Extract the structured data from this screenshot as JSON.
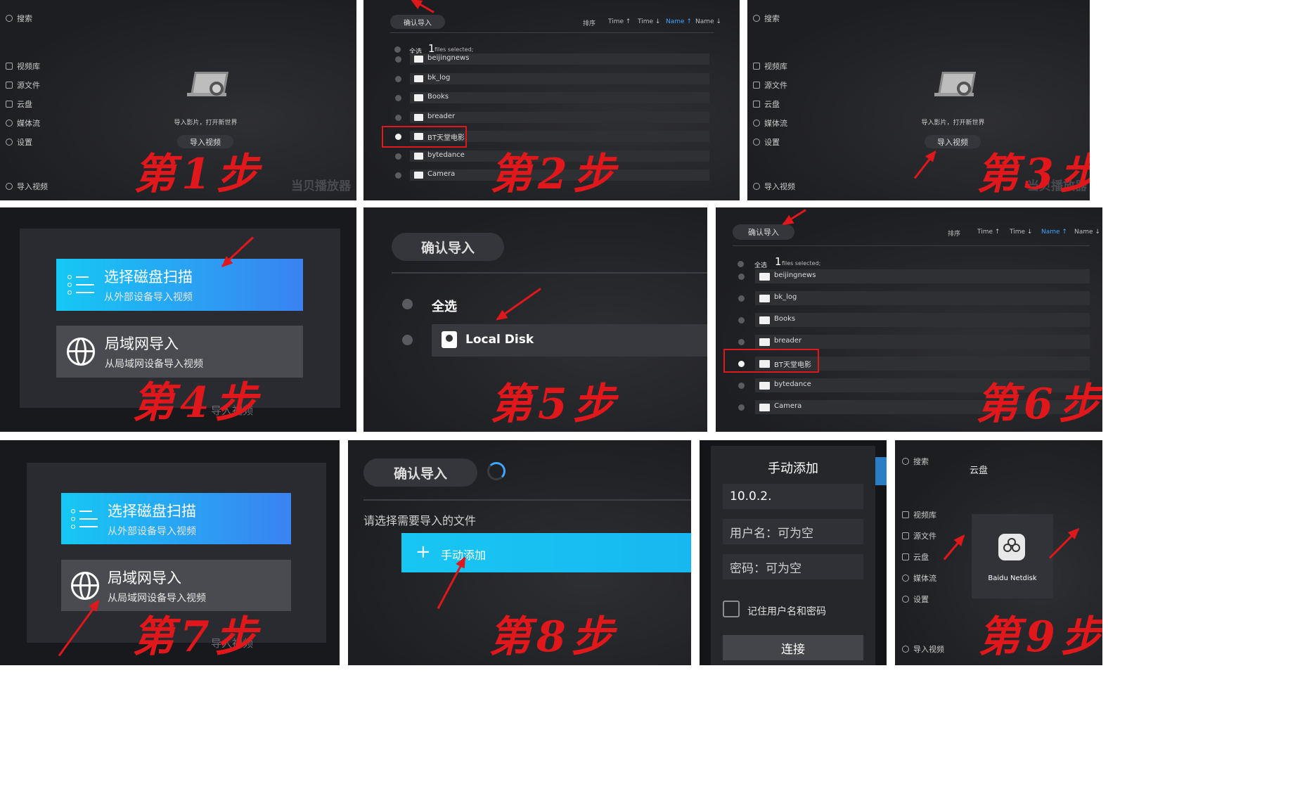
{
  "steps": [
    "第1步",
    "第2步",
    "第3步",
    "第4步",
    "第5步",
    "第6步",
    "第7步",
    "第8步",
    "第9步"
  ],
  "sidebar": {
    "search": "搜索",
    "items": [
      "视频库",
      "源文件",
      "云盘",
      "媒体流",
      "设置"
    ],
    "import_video": "导入视频"
  },
  "empty_state": {
    "message": "导入影片，打开新世界",
    "button": "导入视频",
    "watermark": "当贝播放器"
  },
  "file_browser": {
    "confirm_button": "确认导入",
    "sort": {
      "label": "排序",
      "options": [
        "Time ↑",
        "Time ↓",
        "Name ↑",
        "Name ↓"
      ],
      "active": "Name ↑"
    },
    "select_all": "全选",
    "selected_count": "1",
    "selected_suffix": "files selected;",
    "folders": [
      "beijingnews",
      "bk_log",
      "Books",
      "breader",
      "BT天堂电影",
      "bytedance",
      "Camera"
    ],
    "checked_folder": "BT天堂电影"
  },
  "import_dialog": {
    "disk_title": "选择磁盘扫描",
    "disk_sub": "从外部设备导入视频",
    "lan_title": "局域网导入",
    "lan_sub": "从局域网设备导入视频",
    "behind_text": "导入视频"
  },
  "disk_select": {
    "confirm_button": "确认导入",
    "select_all": "全选",
    "disk_name": "Local Disk"
  },
  "lan_files": {
    "confirm_button": "确认导入",
    "prompt": "请选择需要导入的文件",
    "manual_add": "手动添加"
  },
  "manual_form": {
    "title": "手动添加",
    "ip_value": "10.0.2.",
    "username_placeholder": "用户名：可为空",
    "password_placeholder": "密码：可为空",
    "remember_label": "记住用户名和密码",
    "connect_button": "连接"
  },
  "cloud": {
    "header": "云盘",
    "service_name": "Baidu Netdisk"
  }
}
